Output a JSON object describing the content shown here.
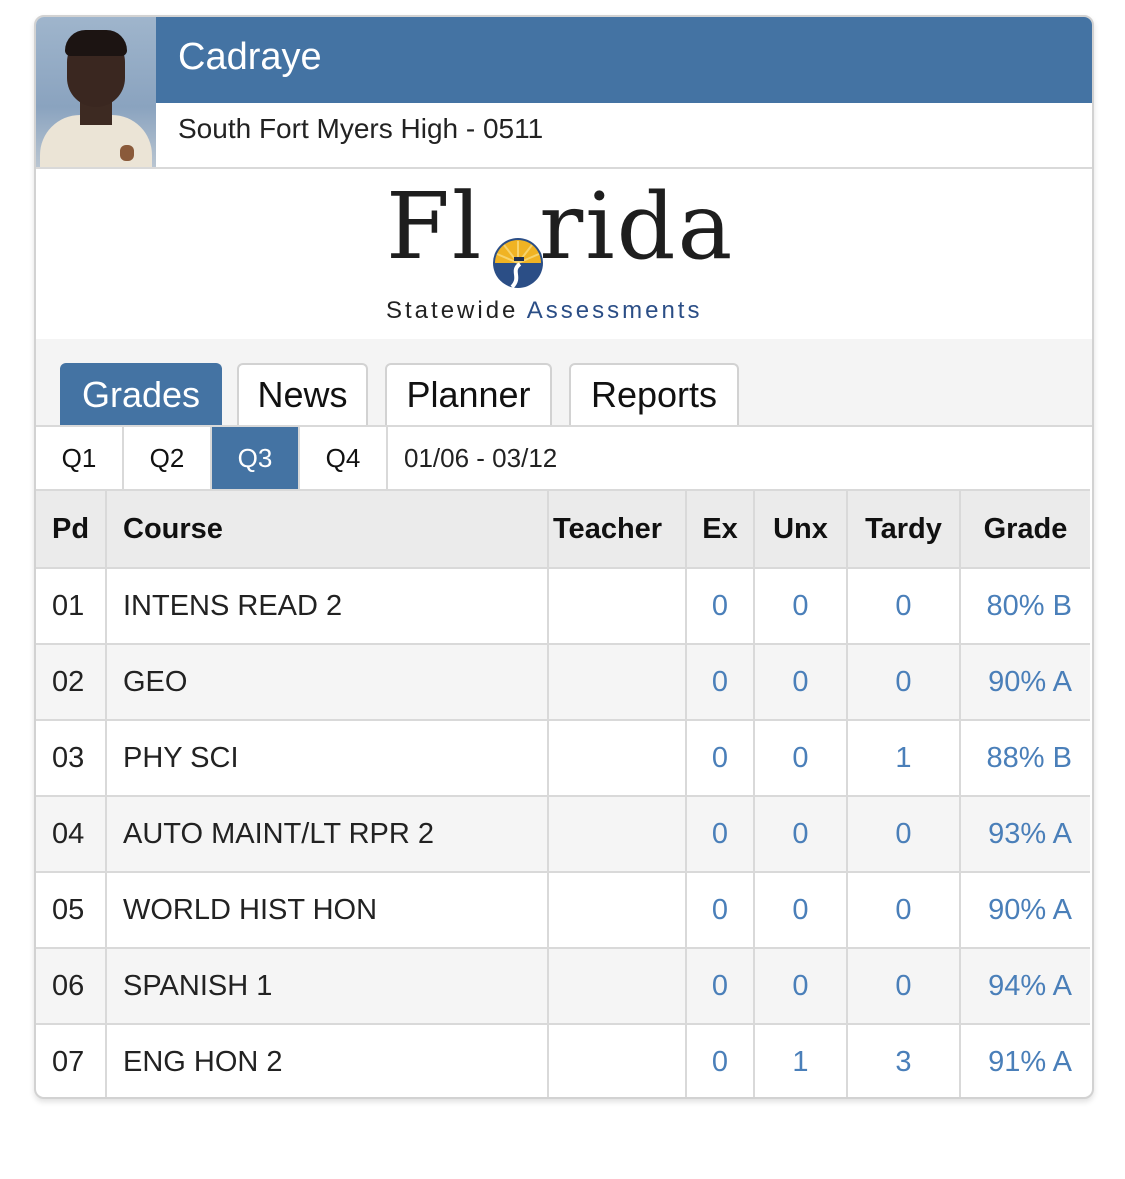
{
  "student": {
    "name": "Cadraye",
    "school": "South Fort Myers High - 0511"
  },
  "logo": {
    "word_left": "Fl",
    "word_right": "rida",
    "sub_left": "Statewide",
    "sub_right": "Assessments",
    "colors": {
      "text": "#1e1e1e",
      "accent": "#2b4e86",
      "sun": "#f0b323"
    }
  },
  "tabs": [
    {
      "label": "Grades",
      "active": true
    },
    {
      "label": "News",
      "active": false
    },
    {
      "label": "Planner",
      "active": false
    },
    {
      "label": "Reports",
      "active": false
    }
  ],
  "quarters": {
    "items": [
      "Q1",
      "Q2",
      "Q3",
      "Q4"
    ],
    "selected": "Q3",
    "date_range": "01/06 - 03/12"
  },
  "table": {
    "headers": {
      "pd": "Pd",
      "course": "Course",
      "teacher": "Teacher",
      "ex": "Ex",
      "unx": "Unx",
      "tardy": "Tardy",
      "grade": "Grade"
    },
    "rows": [
      {
        "pd": "01",
        "course": "INTENS READ 2",
        "teacher": "",
        "ex": "0",
        "unx": "0",
        "tardy": "0",
        "grade": "80% B"
      },
      {
        "pd": "02",
        "course": "GEO",
        "teacher": "",
        "ex": "0",
        "unx": "0",
        "tardy": "0",
        "grade": "90% A"
      },
      {
        "pd": "03",
        "course": "PHY SCI",
        "teacher": "",
        "ex": "0",
        "unx": "0",
        "tardy": "1",
        "grade": "88% B"
      },
      {
        "pd": "04",
        "course": "AUTO MAINT/LT RPR 2",
        "teacher": "",
        "ex": "0",
        "unx": "0",
        "tardy": "0",
        "grade": "93% A"
      },
      {
        "pd": "05",
        "course": "WORLD HIST HON",
        "teacher": "",
        "ex": "0",
        "unx": "0",
        "tardy": "0",
        "grade": "90% A"
      },
      {
        "pd": "06",
        "course": "SPANISH 1",
        "teacher": "",
        "ex": "0",
        "unx": "0",
        "tardy": "0",
        "grade": "94% A"
      },
      {
        "pd": "07",
        "course": "ENG HON 2",
        "teacher": "",
        "ex": "0",
        "unx": "1",
        "tardy": "3",
        "grade": "91% A"
      }
    ]
  },
  "colors": {
    "accent": "#4473a3",
    "link": "#4a7fb9"
  }
}
